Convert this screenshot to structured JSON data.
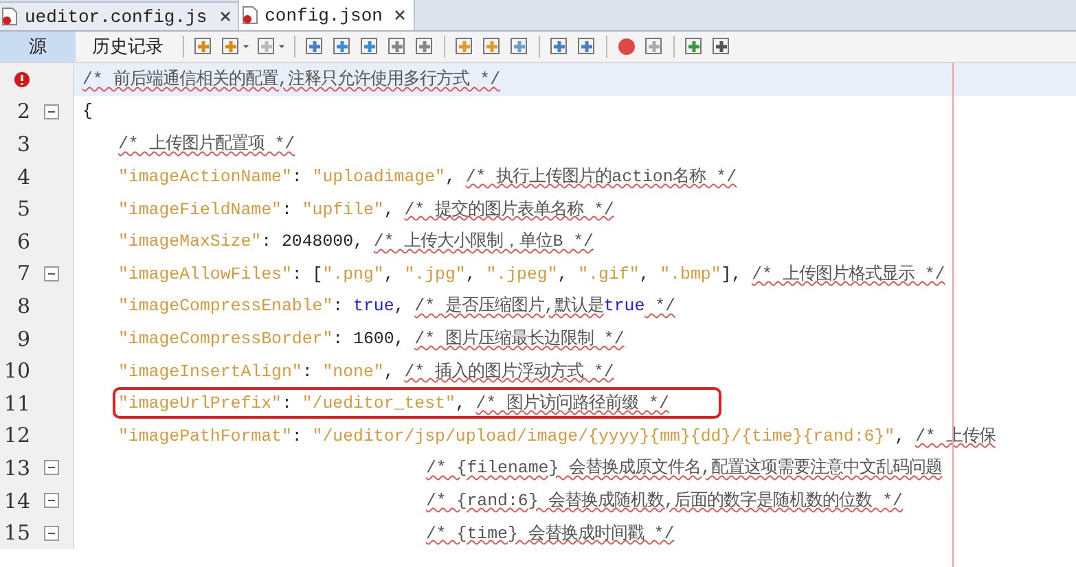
{
  "tabs": [
    {
      "label": "ueditor.config.js",
      "selected": false
    },
    {
      "label": "config.json",
      "selected": true
    }
  ],
  "toolbar": {
    "views": [
      {
        "label": "源",
        "selected": true
      },
      {
        "label": "历史记录",
        "selected": false
      }
    ]
  },
  "editor": {
    "lines": [
      {
        "kind": "top",
        "current": true,
        "error": true,
        "foldable": false,
        "highlighted": false,
        "tokens": [
          {
            "kind": "comment",
            "text": "/* 前后端通信相关的配置,注释只允许使用多行方式 */"
          }
        ]
      },
      {
        "number": "2",
        "kind": "top",
        "current": false,
        "error": false,
        "foldable": true,
        "highlighted": false,
        "tokens": [
          {
            "kind": "punct",
            "text": "{"
          }
        ]
      },
      {
        "number": "3",
        "kind": "member",
        "current": false,
        "error": false,
        "foldable": false,
        "highlighted": false,
        "tokens": [
          {
            "kind": "comment",
            "text": "/* 上传图片配置项 */"
          }
        ]
      },
      {
        "number": "4",
        "kind": "member",
        "current": false,
        "error": false,
        "foldable": false,
        "highlighted": false,
        "tokens": [
          {
            "kind": "key",
            "text": "\"imageActionName\""
          },
          {
            "kind": "punct",
            "text": ": "
          },
          {
            "kind": "string",
            "text": "\"uploadimage\""
          },
          {
            "kind": "punct",
            "text": ", "
          },
          {
            "kind": "comment",
            "text": "/* 执行上传图片的action名称 */"
          }
        ]
      },
      {
        "number": "5",
        "kind": "member",
        "current": false,
        "error": false,
        "foldable": false,
        "highlighted": false,
        "tokens": [
          {
            "kind": "key",
            "text": "\"imageFieldName\""
          },
          {
            "kind": "punct",
            "text": ": "
          },
          {
            "kind": "string",
            "text": "\"upfile\""
          },
          {
            "kind": "punct",
            "text": ", "
          },
          {
            "kind": "comment",
            "text": "/* 提交的图片表单名称 */"
          }
        ]
      },
      {
        "number": "6",
        "kind": "member",
        "current": false,
        "error": false,
        "foldable": false,
        "highlighted": false,
        "tokens": [
          {
            "kind": "key",
            "text": "\"imageMaxSize\""
          },
          {
            "kind": "punct",
            "text": ": "
          },
          {
            "kind": "number",
            "text": "2048000"
          },
          {
            "kind": "punct",
            "text": ", "
          },
          {
            "kind": "comment",
            "text": "/* 上传大小限制，单位B */"
          }
        ]
      },
      {
        "number": "7",
        "kind": "member",
        "current": false,
        "error": false,
        "foldable": true,
        "highlighted": false,
        "tokens": [
          {
            "kind": "key",
            "text": "\"imageAllowFiles\""
          },
          {
            "kind": "punct",
            "text": ": ["
          },
          {
            "kind": "string",
            "text": "\".png\""
          },
          {
            "kind": "punct",
            "text": ", "
          },
          {
            "kind": "string",
            "text": "\".jpg\""
          },
          {
            "kind": "punct",
            "text": ", "
          },
          {
            "kind": "string",
            "text": "\".jpeg\""
          },
          {
            "kind": "punct",
            "text": ", "
          },
          {
            "kind": "string",
            "text": "\".gif\""
          },
          {
            "kind": "punct",
            "text": ", "
          },
          {
            "kind": "string",
            "text": "\".bmp\""
          },
          {
            "kind": "punct",
            "text": "], "
          },
          {
            "kind": "comment",
            "text": "/* 上传图片格式显示 */"
          }
        ]
      },
      {
        "number": "8",
        "kind": "member",
        "current": false,
        "error": false,
        "foldable": false,
        "highlighted": false,
        "tokens": [
          {
            "kind": "key",
            "text": "\"imageCompressEnable\""
          },
          {
            "kind": "punct",
            "text": ": "
          },
          {
            "kind": "keyword",
            "text": "true"
          },
          {
            "kind": "punct",
            "text": ", "
          },
          {
            "kind": "comment",
            "text": "/* 是否压缩图片,默认是"
          },
          {
            "kind": "keyword",
            "text": "true"
          },
          {
            "kind": "comment",
            "text": " */"
          }
        ]
      },
      {
        "number": "9",
        "kind": "member",
        "current": false,
        "error": false,
        "foldable": false,
        "highlighted": false,
        "tokens": [
          {
            "kind": "key",
            "text": "\"imageCompressBorder\""
          },
          {
            "kind": "punct",
            "text": ": "
          },
          {
            "kind": "number",
            "text": "1600"
          },
          {
            "kind": "punct",
            "text": ", "
          },
          {
            "kind": "comment",
            "text": "/* 图片压缩最长边限制 */"
          }
        ]
      },
      {
        "number": "10",
        "kind": "member",
        "current": false,
        "error": false,
        "foldable": false,
        "highlighted": false,
        "tokens": [
          {
            "kind": "key",
            "text": "\"imageInsertAlign\""
          },
          {
            "kind": "punct",
            "text": ": "
          },
          {
            "kind": "string",
            "text": "\"none\""
          },
          {
            "kind": "punct",
            "text": ", "
          },
          {
            "kind": "comment",
            "text": "/* 插入的图片浮动方式 */"
          }
        ]
      },
      {
        "number": "11",
        "kind": "member",
        "current": false,
        "error": false,
        "foldable": false,
        "highlighted": true,
        "tokens": [
          {
            "kind": "key",
            "text": "\"imageUrlPrefix\""
          },
          {
            "kind": "punct",
            "text": ": "
          },
          {
            "kind": "string",
            "text": "\"/ueditor_test\""
          },
          {
            "kind": "punct",
            "text": ", "
          },
          {
            "kind": "comment",
            "text": "/* 图片访问路径前缀 */"
          }
        ]
      },
      {
        "number": "12",
        "kind": "member",
        "current": false,
        "error": false,
        "foldable": false,
        "highlighted": false,
        "tokens": [
          {
            "kind": "key",
            "text": "\"imagePathFormat\""
          },
          {
            "kind": "punct",
            "text": ": "
          },
          {
            "kind": "string",
            "text": "\"/ueditor/jsp/upload/image/{yyyy}{mm}{dd}/{time}{rand:6}\""
          },
          {
            "kind": "punct",
            "text": ", "
          },
          {
            "kind": "comment",
            "text": "/* 上传保"
          }
        ]
      },
      {
        "number": "13",
        "kind": "continuation",
        "current": false,
        "error": false,
        "foldable": true,
        "highlighted": false,
        "tokens": [
          {
            "kind": "comment",
            "text": "/* {filename} 会替换成原文件名,配置这项需要注意中文乱码问题"
          }
        ]
      },
      {
        "number": "14",
        "kind": "continuation",
        "current": false,
        "error": false,
        "foldable": true,
        "highlighted": false,
        "tokens": [
          {
            "kind": "comment",
            "text": "/* {rand:6} 会替换成随机数,后面的数字是随机数的位数 */"
          }
        ]
      },
      {
        "number": "15",
        "kind": "continuation",
        "current": false,
        "error": false,
        "foldable": true,
        "highlighted": false,
        "tokens": [
          {
            "kind": "comment",
            "text": "/* {time} 会替换成时间戳 */"
          }
        ]
      }
    ]
  }
}
